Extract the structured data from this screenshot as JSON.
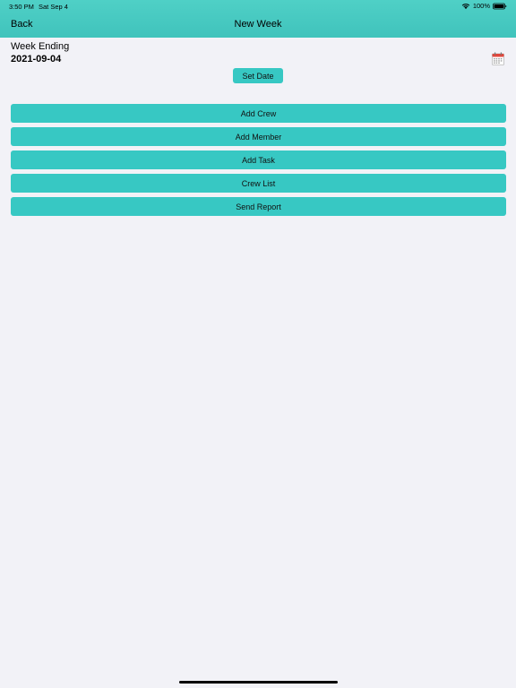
{
  "status_bar": {
    "time": "3:50 PM",
    "date": "Sat Sep 4",
    "battery": "100%",
    "wifi_icon": "wifi-icon",
    "battery_icon": "battery-icon"
  },
  "nav": {
    "back_label": "Back",
    "title": "New Week"
  },
  "week": {
    "label": "Week Ending",
    "date": "2021-09-04",
    "calendar_icon": "calendar-icon",
    "set_date_label": "Set Date"
  },
  "menu": {
    "add_crew": "Add Crew",
    "add_member": "Add Member",
    "add_task": "Add Task",
    "crew_list": "Crew List",
    "send_report": "Send Report"
  },
  "colors": {
    "header": "#45c8c0",
    "button": "#37c8c3",
    "background": "#f2f2f7"
  }
}
